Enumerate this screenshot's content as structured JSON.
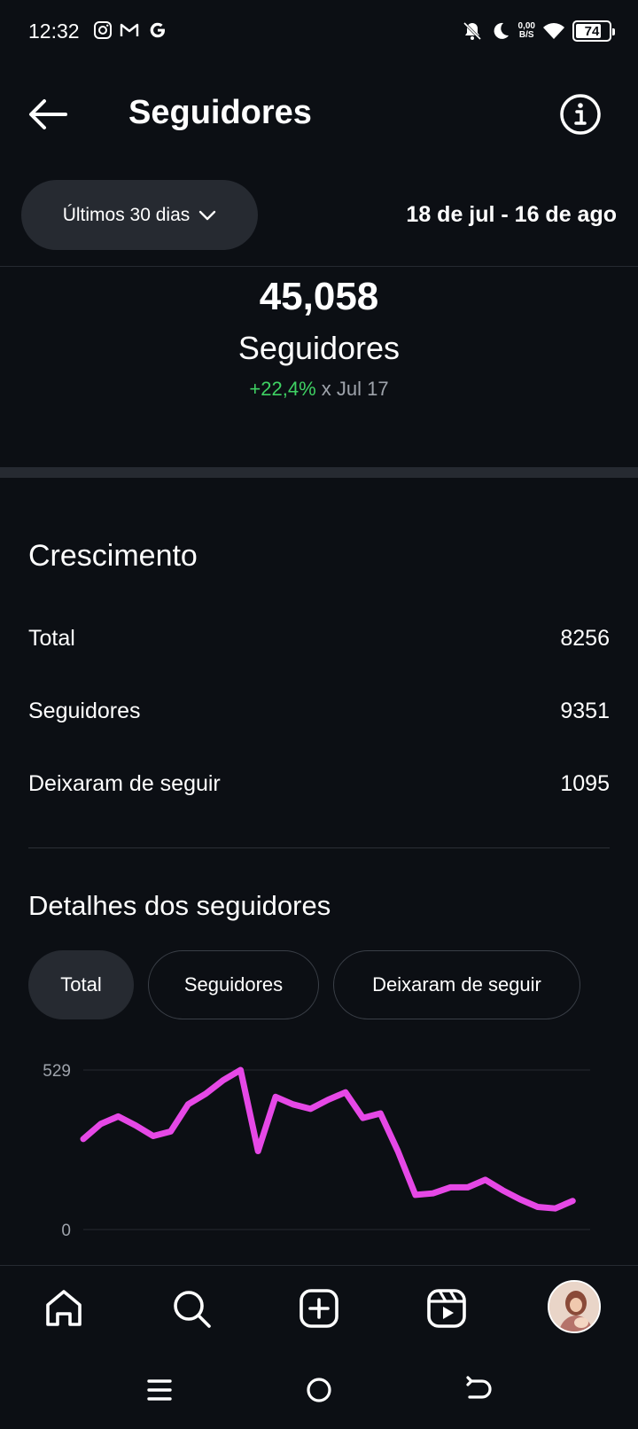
{
  "status_bar": {
    "time": "12:32",
    "icons": [
      "instagram-icon",
      "gmail-icon",
      "google-icon"
    ],
    "net_speed_value": "0,00",
    "net_speed_unit": "B/S",
    "battery": "74"
  },
  "header": {
    "title": "Seguidores"
  },
  "range": {
    "selected": "Últimos 30 dias",
    "dates": "18 de jul - 16 de ago"
  },
  "summary": {
    "count": "45,058",
    "label": "Seguidores",
    "change_value": "+22,4%",
    "change_suffix": "x Jul 17"
  },
  "growth": {
    "title": "Crescimento",
    "rows": [
      {
        "label": "Total",
        "value": "8256"
      },
      {
        "label": "Seguidores",
        "value": "9351"
      },
      {
        "label": "Deixaram de seguir",
        "value": "1095"
      }
    ]
  },
  "details": {
    "title": "Detalhes dos seguidores",
    "tabs": [
      {
        "label": "Total",
        "active": true
      },
      {
        "label": "Seguidores",
        "active": false
      },
      {
        "label": "Deixaram de seguir",
        "active": false
      }
    ]
  },
  "chart_data": {
    "type": "line",
    "color": "#e648e6",
    "ytick_labels": [
      "529",
      "0"
    ],
    "ylim": [
      0,
      529
    ],
    "x": [
      1,
      2,
      3,
      4,
      5,
      6,
      7,
      8,
      9,
      10,
      11,
      12,
      13,
      14,
      15,
      16,
      17,
      18,
      19,
      20,
      21,
      22,
      23,
      24,
      25,
      26,
      27,
      28,
      29,
      30
    ],
    "series": [
      {
        "values": [
          300,
          350,
          375,
          345,
          310,
          325,
          415,
          450,
          495,
          529,
          260,
          440,
          415,
          400,
          430,
          455,
          370,
          385,
          260,
          115,
          120,
          140,
          140,
          165,
          130,
          100,
          75,
          70,
          95,
          null
        ]
      }
    ]
  },
  "bottom_nav": {
    "items": [
      "home-icon",
      "search-icon",
      "create-icon",
      "reels-icon",
      "profile-avatar"
    ]
  }
}
